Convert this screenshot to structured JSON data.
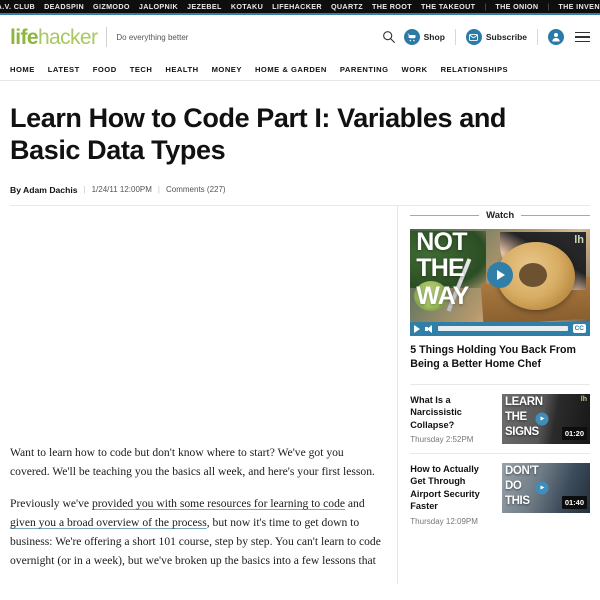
{
  "network_bar": {
    "links": [
      "THE A.V. CLUB",
      "DEADSPIN",
      "GIZMODO",
      "JALOPNIK",
      "JEZEBEL",
      "KOTAKU",
      "LIFEHACKER",
      "QUARTZ",
      "THE ROOT",
      "THE TAKEOUT",
      "THE ONION",
      "THE INVENTORY"
    ],
    "separator": "|"
  },
  "masthead": {
    "logo_part1": "life",
    "logo_part2": "hacker",
    "tagline": "Do everything better",
    "shop_label": "Shop",
    "subscribe_label": "Subscribe",
    "brand_green": "#8cb63c",
    "brand_blue": "#2b7aa8"
  },
  "section_nav": {
    "items": [
      "HOME",
      "LATEST",
      "FOOD",
      "TECH",
      "HEALTH",
      "MONEY",
      "HOME & GARDEN",
      "PARENTING",
      "WORK",
      "RELATIONSHIPS"
    ]
  },
  "article": {
    "headline": "Learn How to Code Part I: Variables and Basic Data Types",
    "author": "By Adam Dachis",
    "timestamp": "1/24/11 12:00PM",
    "comments": "Comments (227)",
    "divider": "|",
    "paragraph1": "Want to learn how to code but don't know where to start? We've got you covered. We'll be teaching you the basics all week, and here's your first lesson.",
    "paragraph2_pre": "Previously we've ",
    "paragraph2_link1": "provided you with some resources for learning to code",
    "paragraph2_mid": " and ",
    "paragraph2_link2": "given you a broad overview of the process",
    "paragraph2_post": ", but now it's time to get down to business: We're offering a short 101 course, step by step. You can't learn to code overnight (or in a week), but we've broken up the basics into a few lessons that"
  },
  "rail": {
    "section_title": "Watch",
    "player": {
      "overlay_line1": "NOT",
      "overlay_line2": "THE",
      "overlay_line3": "WAY",
      "watermark": "lh",
      "cc_label": "CC",
      "title": "5 Things Holding You Back From Being a Better Home Chef"
    },
    "items": [
      {
        "title": "What Is a Narcissistic Collapse?",
        "time": "Thursday 2:52PM",
        "duration": "01:20",
        "thumb_line1": "LEARN",
        "thumb_line2": "THE",
        "thumb_line3": "SIGNS",
        "watermark": "lh"
      },
      {
        "title": "How to Actually Get Through Airport Security Faster",
        "time": "Thursday 12:09PM",
        "duration": "01:40",
        "thumb_line1": "DON'T",
        "thumb_line2": "DO",
        "thumb_line3": "THIS",
        "watermark": ""
      }
    ]
  }
}
